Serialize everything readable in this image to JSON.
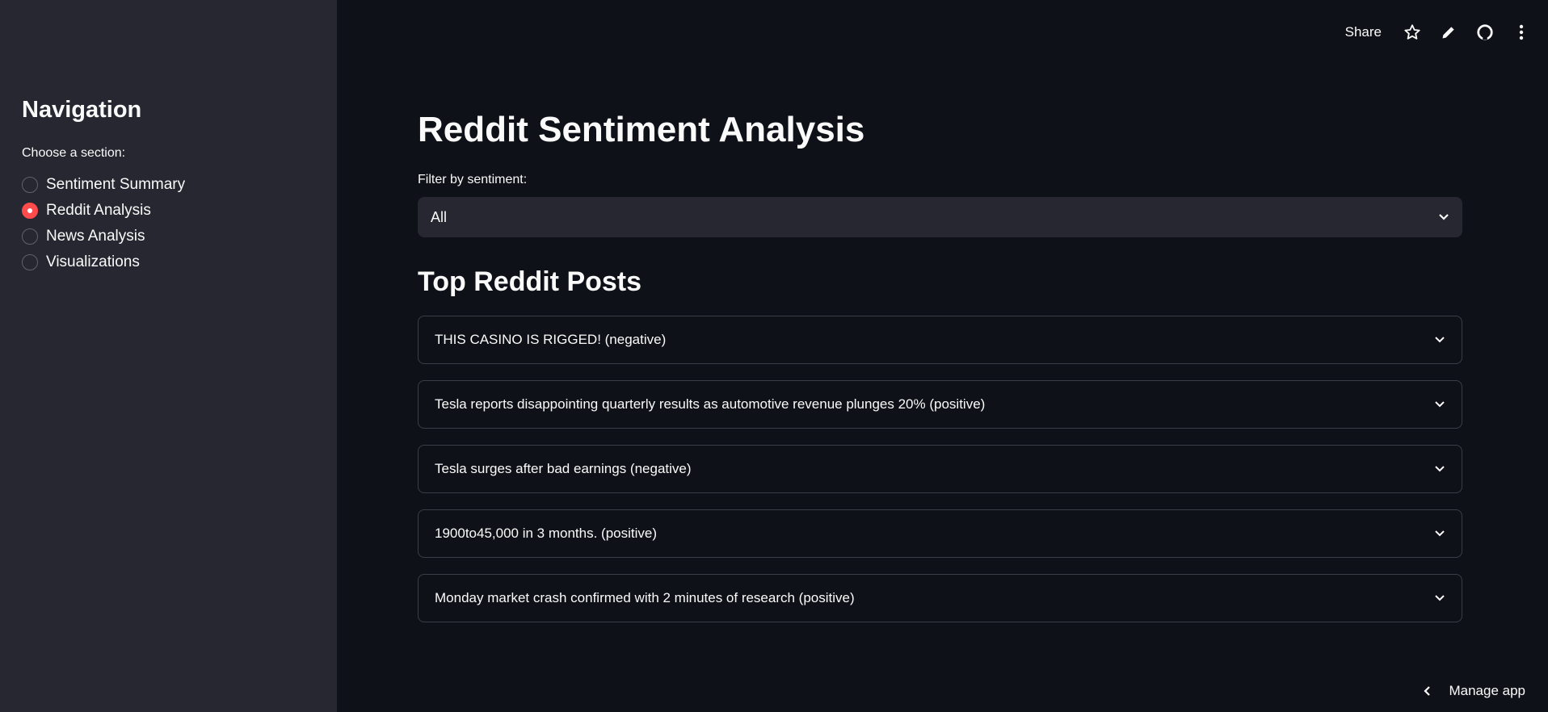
{
  "sidebar": {
    "title": "Navigation",
    "radio_label": "Choose a section:",
    "options": [
      "Sentiment Summary",
      "Reddit Analysis",
      "News Analysis",
      "Visualizations"
    ],
    "selected": "Reddit Analysis"
  },
  "header": {
    "share": "Share"
  },
  "main": {
    "title": "Reddit Sentiment Analysis",
    "filter_label": "Filter by sentiment:",
    "filter_value": "All",
    "section_title": "Top Reddit Posts",
    "posts": [
      "THIS CASINO IS RIGGED! (negative)",
      "Tesla reports disappointing quarterly results as automotive revenue plunges 20% (positive)",
      "Tesla surges after bad earnings (negative)",
      "1900to45,000 in 3 months. (positive)",
      "Monday market crash confirmed with 2 minutes of research (positive)"
    ]
  },
  "footer": {
    "manage": "Manage app"
  },
  "colors": {
    "accent": "#ff4b4b",
    "sidebar": "#262730",
    "background": "#0e1117"
  }
}
